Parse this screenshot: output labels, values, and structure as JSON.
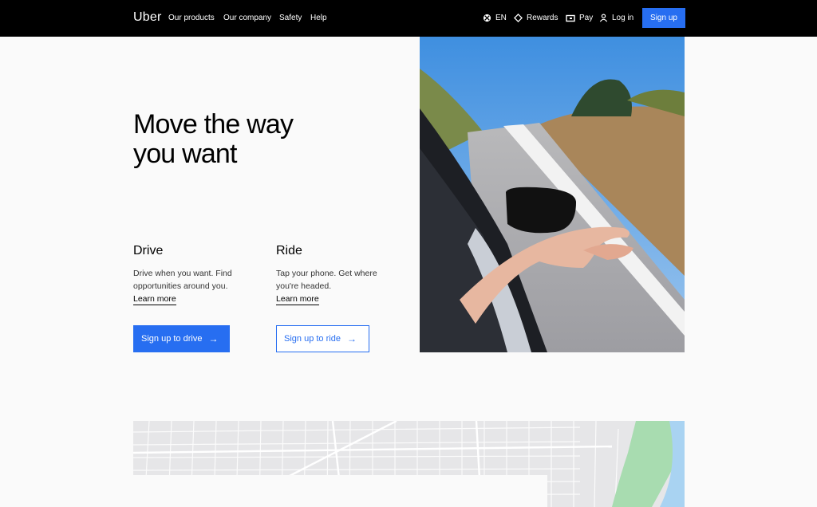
{
  "nav": {
    "logo": "Uber",
    "links": [
      "Our products",
      "Our company",
      "Safety",
      "Help"
    ],
    "language": "EN",
    "rewards": "Rewards",
    "pay": "Pay",
    "login": "Log in",
    "signup": "Sign up"
  },
  "hero": {
    "title_line1": "Move the way",
    "title_line2": "you want"
  },
  "drive": {
    "title": "Drive",
    "text_line1": "Drive when you want. Find",
    "text_line2": "opportunities around you.",
    "learn_more": "Learn more",
    "button": "Sign up to drive"
  },
  "ride": {
    "title": "Ride",
    "text_line1": "Tap your phone. Get where",
    "text_line2": "you're headed.",
    "learn_more": "Learn more",
    "button": "Sign up to ride"
  },
  "colors": {
    "accent": "#276ef1",
    "nav_bg": "#000000"
  },
  "icons": {
    "language": "globe-icon",
    "rewards": "diamond-icon",
    "pay": "wallet-icon",
    "login": "person-icon",
    "arrow": "arrow-right-icon"
  }
}
